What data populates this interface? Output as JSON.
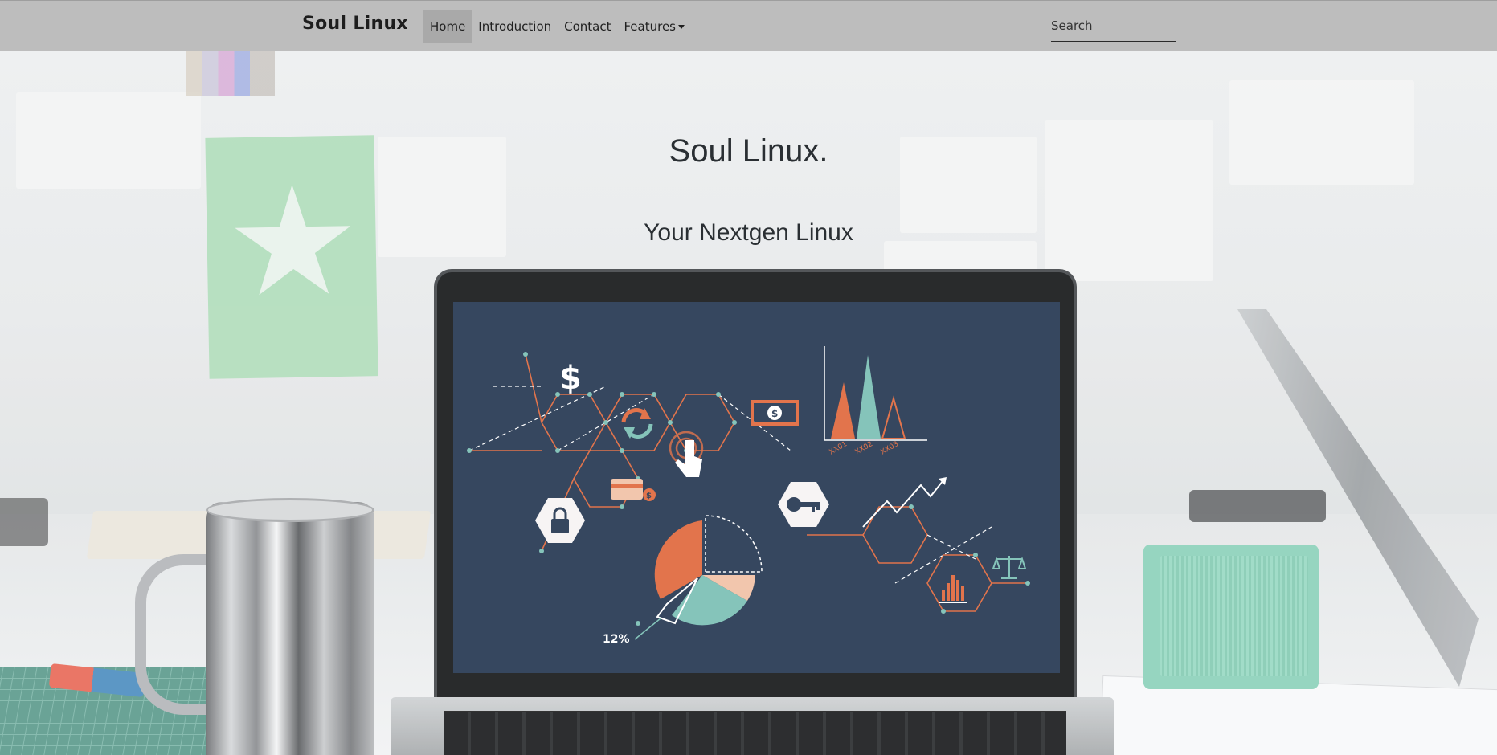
{
  "navbar": {
    "brand": "Soul Linux",
    "items": [
      {
        "label": "Home",
        "active": true
      },
      {
        "label": "Introduction",
        "active": false
      },
      {
        "label": "Contact",
        "active": false
      },
      {
        "label": "Features",
        "active": false,
        "dropdown": true
      }
    ],
    "search": {
      "placeholder": "Search",
      "value": ""
    }
  },
  "hero": {
    "title": "Soul Linux.",
    "subtitle": "Your Nextgen Linux"
  },
  "screen_graphic": {
    "percent_label": "12%",
    "axis_labels": [
      "XX01",
      "XX02",
      "XX03"
    ],
    "icons": [
      "dollar-icon",
      "refresh-icon",
      "touch-icon",
      "banknote-icon",
      "credit-card-icon",
      "lock-icon",
      "key-icon",
      "trend-arrow-icon",
      "bar-chart-icon",
      "scale-icon",
      "pie-chart-icon"
    ]
  },
  "colors": {
    "navbar_bg": "#bdbdbd",
    "nav_active_bg": "#a9a9a9",
    "screen_bg": "#253852",
    "accent_orange": "#e0693d",
    "accent_teal": "#7bbfb5",
    "accent_peach": "#f1c2a6"
  }
}
